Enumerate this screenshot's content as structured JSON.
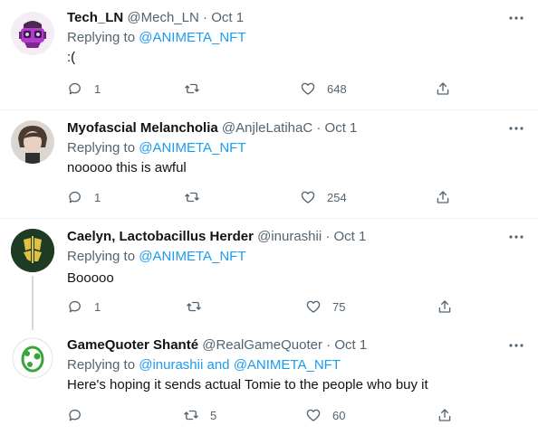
{
  "tweets": [
    {
      "name": "Tech_LN",
      "handle": "@Mech_LN",
      "dot": "·",
      "time": "Oct 1",
      "reply_prefix": "Replying to ",
      "reply_mentions": "@ANIMETA_NFT",
      "reply_joiner": "",
      "reply_mentions2": "",
      "text": ":(",
      "replies": "1",
      "retweets": "",
      "likes": "648"
    },
    {
      "name": "Myofascial Melancholia",
      "handle": "@AnjleLatihaC",
      "dot": "·",
      "time": "Oct 1",
      "reply_prefix": "Replying to ",
      "reply_mentions": "@ANIMETA_NFT",
      "reply_joiner": "",
      "reply_mentions2": "",
      "text": "nooooo this is awful",
      "replies": "1",
      "retweets": "",
      "likes": "254"
    },
    {
      "name": "Caelyn, Lactobacillus Herder",
      "handle": "@inurashii",
      "dot": "·",
      "time": "Oct 1",
      "reply_prefix": "Replying to ",
      "reply_mentions": "@ANIMETA_NFT",
      "reply_joiner": "",
      "reply_mentions2": "",
      "text": "Booooo",
      "replies": "1",
      "retweets": "",
      "likes": "75"
    },
    {
      "name": "GameQuoter Shanté",
      "handle": "@RealGameQuoter",
      "dot": "·",
      "time": "Oct 1",
      "reply_prefix": "Replying to ",
      "reply_mentions": "@inurashii",
      "reply_joiner": " and ",
      "reply_mentions2": "@ANIMETA_NFT",
      "text": "Here's hoping it sends actual Tomie to the people who buy it",
      "replies": "",
      "retweets": "5",
      "likes": "60"
    }
  ],
  "colors": {
    "text": "#0f1419",
    "secondary": "#536471",
    "mention": "#1d9bf0",
    "divider": "#eff3f4",
    "thread_line": "#cfd9de"
  },
  "icons": {
    "reply": "reply-icon",
    "retweet": "retweet-icon",
    "like": "heart-icon",
    "share": "share-icon",
    "more": "more-icon"
  }
}
